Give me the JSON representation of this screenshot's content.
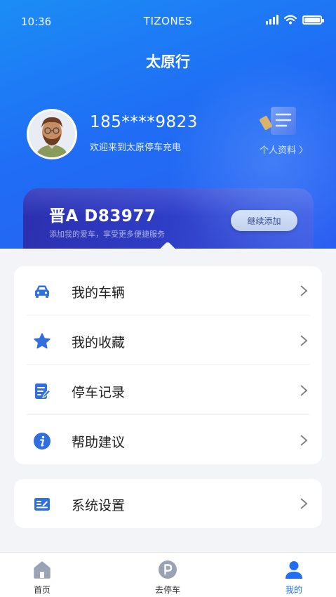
{
  "status_bar": {
    "time": "10:36",
    "carrier": "TIZONES"
  },
  "header": {
    "title": "太原行"
  },
  "user": {
    "phone": "185****9823",
    "welcome": "欢迎来到太原停车充电",
    "profile_link": "个人资料 〉"
  },
  "car_card": {
    "plate": "晋A D83977",
    "subtitle": "添加我的爱车，享受更多便捷服务",
    "add_button": "继续添加"
  },
  "menu": {
    "items": [
      {
        "label": "我的车辆",
        "icon": "car-icon"
      },
      {
        "label": "我的收藏",
        "icon": "star-icon"
      },
      {
        "label": "停车记录",
        "icon": "document-edit-icon"
      },
      {
        "label": "帮助建议",
        "icon": "info-icon"
      }
    ],
    "settings": {
      "label": "系统设置",
      "icon": "settings-form-icon"
    }
  },
  "tabbar": {
    "tabs": [
      {
        "label": "首页",
        "icon": "home-icon",
        "active": false
      },
      {
        "label": "去停车",
        "icon": "parking-icon",
        "active": false
      },
      {
        "label": "我的",
        "icon": "person-icon",
        "active": true
      }
    ]
  },
  "colors": {
    "accent": "#1f6ef5",
    "header_start": "#1b8df5",
    "card_start": "#2b2fae",
    "icon_blue": "#2f6fe0"
  }
}
